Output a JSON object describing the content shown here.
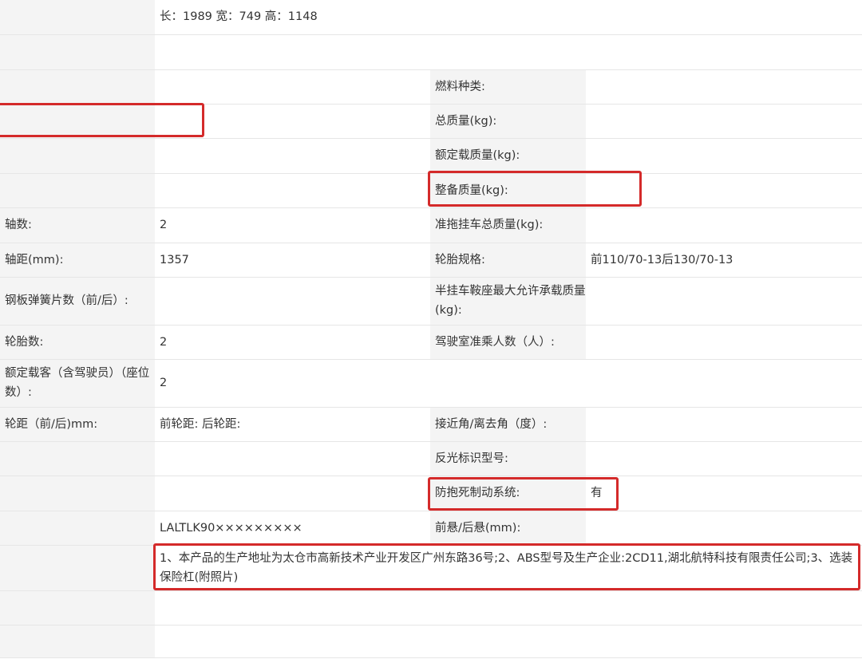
{
  "colors": {
    "label_bg": "#f4f4f4",
    "value_bg": "#ffffff",
    "highlight": "#d42a2a",
    "text": "#333333"
  },
  "rows": {
    "dimensions": {
      "value": "长：1989 宽：749 高：1148"
    },
    "fuel": {
      "label": "燃料种类:"
    },
    "total_mass": {
      "label": "总质量(kg):"
    },
    "rated_load": {
      "label": "额定载质量(kg):"
    },
    "curb_weight": {
      "label": "整备质量(kg):"
    },
    "axles": {
      "label": "轴数:",
      "value": "2"
    },
    "trailer_mass": {
      "label": "准拖挂车总质量(kg):"
    },
    "wheelbase": {
      "label": "轴距(mm):",
      "value": "1357"
    },
    "tire_spec": {
      "label": "轮胎规格:",
      "value": "前110/70-13后130/70-13"
    },
    "leaf_springs": {
      "label": "钢板弹簧片数（前/后）:"
    },
    "saddle_load": {
      "label": "半挂车鞍座最大允许承载质量(kg):"
    },
    "tires": {
      "label": "轮胎数:",
      "value": "2"
    },
    "cab_passengers": {
      "label": "驾驶室准乘人数（人）:"
    },
    "passengers": {
      "label": "额定载客（含驾驶员）（座位数）:",
      "value": "2"
    },
    "track": {
      "label": "轮距（前/后)mm:",
      "value": "前轮距: 后轮距:"
    },
    "angles": {
      "label": "接近角/离去角（度）:"
    },
    "reflector": {
      "label": "反光标识型号:"
    },
    "abs": {
      "label": "防抱死制动系统:",
      "value": "有"
    },
    "vin": {
      "value": "LALTLK90×××××××××"
    },
    "overhang": {
      "label": "前悬/后悬(mm):"
    },
    "notes": {
      "value": "1、本产品的生产地址为太仓市高新技术产业开发区广州东路36号;2、ABS型号及生产企业:2CD11,湖北航特科技有限责任公司;3、选装保险杠(附照片)"
    }
  }
}
